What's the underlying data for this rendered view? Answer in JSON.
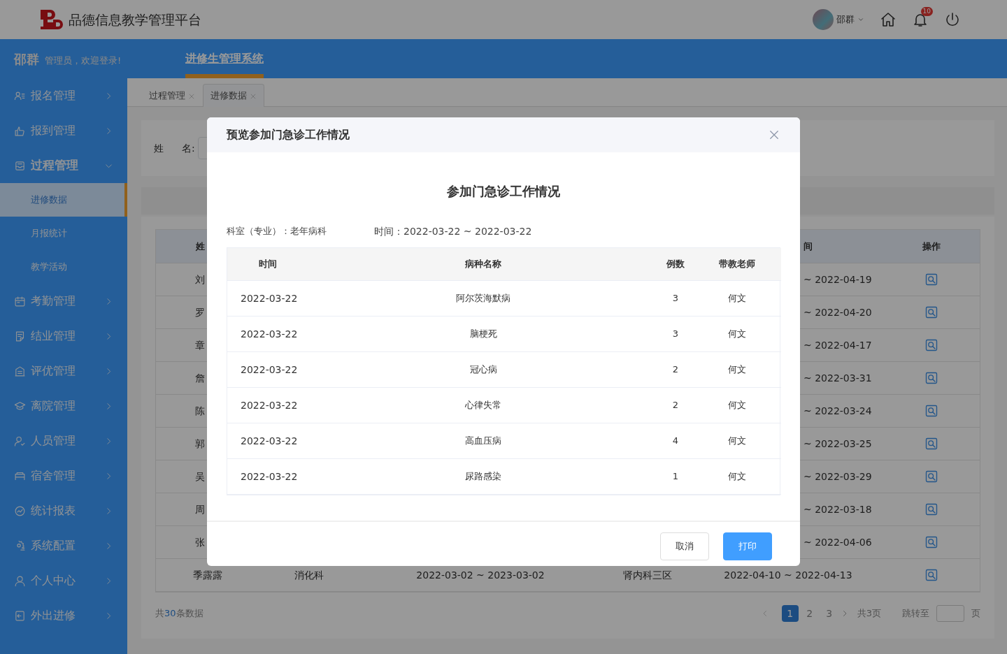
{
  "header": {
    "app_title": "品德信息教学管理平台",
    "user_name": "邵群",
    "notification_count": "10"
  },
  "top_bar": {
    "user": "邵群",
    "greeting": "管理员，欢迎登录!",
    "nav": [
      {
        "label": "进修生管理系统",
        "selected": true
      }
    ]
  },
  "sidebar": {
    "items": [
      {
        "label": "报名管理",
        "expanded": false
      },
      {
        "label": "报到管理",
        "expanded": false
      },
      {
        "label": "过程管理",
        "expanded": true,
        "children": [
          {
            "label": "进修数据",
            "selected": true
          },
          {
            "label": "月报统计",
            "selected": false
          },
          {
            "label": "教学活动",
            "selected": false
          }
        ]
      },
      {
        "label": "考勤管理",
        "expanded": false
      },
      {
        "label": "结业管理",
        "expanded": false
      },
      {
        "label": "评优管理",
        "expanded": false
      },
      {
        "label": "离院管理",
        "expanded": false
      },
      {
        "label": "人员管理",
        "expanded": false
      },
      {
        "label": "宿舍管理",
        "expanded": false
      },
      {
        "label": "统计报表",
        "expanded": false
      },
      {
        "label": "系统配置",
        "expanded": false
      },
      {
        "label": "个人中心",
        "expanded": false
      },
      {
        "label": "外出进修",
        "expanded": false
      }
    ]
  },
  "tabs": [
    {
      "label": "过程管理",
      "selected": false
    },
    {
      "label": "进修数据",
      "selected": true
    }
  ],
  "filter": {
    "label_1": "姓",
    "label_2": "名:"
  },
  "table": {
    "columns": {
      "name": "姓",
      "time": "间",
      "action": "操作"
    },
    "rows": [
      {
        "name": "刘",
        "time": "~ 2022-04-19"
      },
      {
        "name": "罗",
        "time": "~ 2022-04-20"
      },
      {
        "name": "章",
        "time": "~ 2022-04-17"
      },
      {
        "name": "詹",
        "time": "~ 2022-03-31"
      },
      {
        "name": "陈",
        "time": "~ 2022-03-24"
      },
      {
        "name": "郭",
        "time": "~ 2022-03-25"
      },
      {
        "name": "吴",
        "time": "~ 2022-03-29"
      },
      {
        "name": "周",
        "time": "~ 2022-03-18"
      },
      {
        "name": "张",
        "time": "~ 2022-04-06"
      },
      {
        "name": "季露露",
        "department": "消化科",
        "period": "2022-03-02 ~ 2023-03-02",
        "ward": "肾内科三区",
        "time": "2022-04-10 ~ 2022-04-13"
      }
    ]
  },
  "pagination": {
    "total_prefix": "共",
    "total": "30",
    "total_suffix": "条数据",
    "pages": [
      {
        "label": "1",
        "selected": true
      },
      {
        "label": "2",
        "selected": false
      },
      {
        "label": "3",
        "selected": false
      }
    ],
    "page_count": "共3页",
    "jump_label": "跳转至",
    "jump_suffix": "页"
  },
  "modal": {
    "title": "预览参加门急诊工作情况",
    "heading": "参加门急诊工作情况",
    "department": "科室（专业）：老年病科",
    "period": "时间：2022-03-22 ~ 2022-03-22",
    "columns": [
      "时间",
      "病种名称",
      "例数",
      "带教老师"
    ],
    "rows": [
      [
        "2022-03-22",
        "阿尔茨海默病",
        "3",
        "何文"
      ],
      [
        "2022-03-22",
        "脑梗死",
        "3",
        "何文"
      ],
      [
        "2022-03-22",
        "冠心病",
        "2",
        "何文"
      ],
      [
        "2022-03-22",
        "心律失常",
        "2",
        "何文"
      ],
      [
        "2022-03-22",
        "高血压病",
        "4",
        "何文"
      ],
      [
        "2022-03-22",
        "尿路感染",
        "1",
        "何文"
      ]
    ],
    "buttons": [
      {
        "label": "取消",
        "kind": "secondary"
      },
      {
        "label": "打印",
        "kind": "primary"
      }
    ]
  }
}
